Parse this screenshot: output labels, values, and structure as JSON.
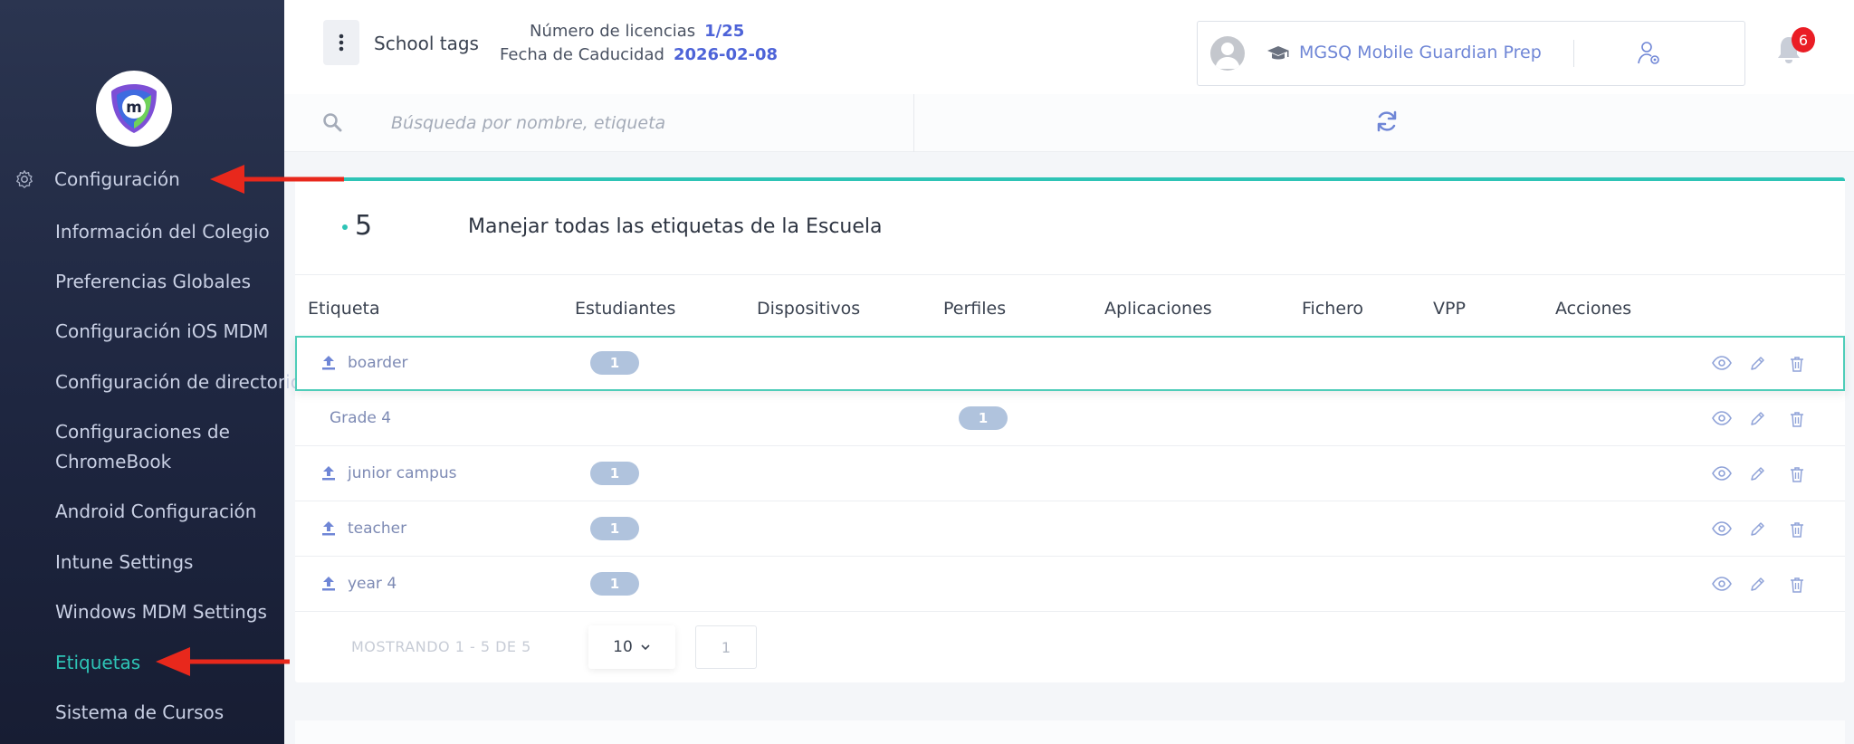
{
  "sidebar": {
    "section_label": "Configuración",
    "items": [
      {
        "label": "Información del Colegio"
      },
      {
        "label": "Preferencias Globales"
      },
      {
        "label": "Configuración iOS MDM"
      },
      {
        "label": "Configuración de directorio"
      },
      {
        "label": "Configuraciones de"
      },
      {
        "label": "ChromeBook"
      },
      {
        "label": "Android Configuración"
      },
      {
        "label": "Intune Settings"
      },
      {
        "label": "Windows MDM Settings"
      },
      {
        "label": "Etiquetas"
      },
      {
        "label": "Sistema de Cursos"
      }
    ],
    "active_item": "Etiquetas"
  },
  "header": {
    "page_title": "School tags",
    "licenses_label": "Número de licencias",
    "licenses_value": "1/25",
    "expiry_label": "Fecha de Caducidad",
    "expiry_value": "2026-02-08",
    "school_name": "MGSQ Mobile Guardian Prep",
    "notification_count": "6"
  },
  "search": {
    "placeholder": "Búsqueda por nombre, etiqueta"
  },
  "card": {
    "count": "5",
    "title": "Manejar todas las etiquetas de la Escuela"
  },
  "table": {
    "columns": [
      "Etiqueta",
      "Estudiantes",
      "Dispositivos",
      "Perfiles",
      "Aplicaciones",
      "Fichero",
      "VPP",
      "Acciones"
    ],
    "rows": [
      {
        "name": "boarder",
        "synced": true,
        "students": "1",
        "profiles": ""
      },
      {
        "name": "Grade 4",
        "synced": false,
        "students": "",
        "profiles": "1"
      },
      {
        "name": "junior campus",
        "synced": true,
        "students": "1",
        "profiles": ""
      },
      {
        "name": "teacher",
        "synced": true,
        "students": "1",
        "profiles": ""
      },
      {
        "name": "year 4",
        "synced": true,
        "students": "1",
        "profiles": ""
      }
    ]
  },
  "pagination": {
    "summary": "MOSTRANDO 1 - 5 DE 5",
    "page_size": "10",
    "page_number": "1"
  },
  "colors": {
    "accent": "#2ec4b6",
    "link": "#4d63d8",
    "annotation_arrow": "#e8281c"
  }
}
